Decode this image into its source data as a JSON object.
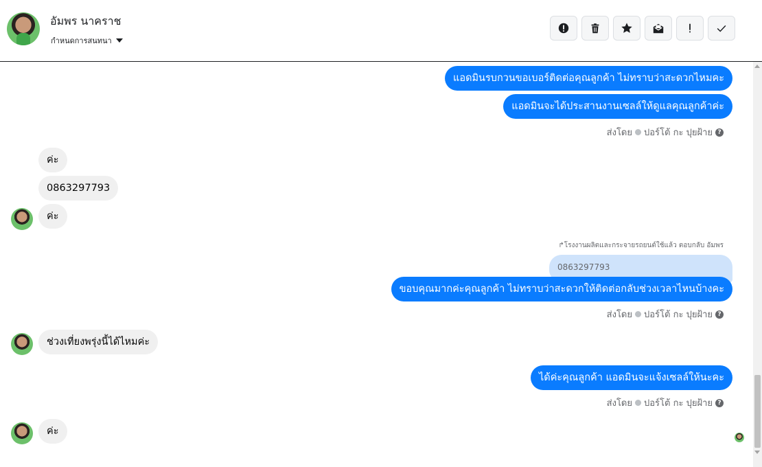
{
  "header": {
    "contact_name": "อัมพร นาคราช",
    "assign_label": "กำหนดการสนทนา",
    "toolbar": [
      {
        "icon": "alert-circle-icon"
      },
      {
        "icon": "trash-icon"
      },
      {
        "icon": "star-icon"
      },
      {
        "icon": "mark-unread-icon"
      },
      {
        "icon": "exclamation-icon"
      },
      {
        "icon": "check-icon"
      }
    ]
  },
  "messages": [
    {
      "dir": "out",
      "text": "แอดมินรบกวนขอเบอร์ติดต่อคุณลูกค้า ไม่ทราบว่าสะดวกไหมคะ"
    },
    {
      "dir": "out",
      "text": "แอดมินจะได้ประสานงานเซลล์ให้ดูแลคุณลูกค้าค่ะ"
    },
    {
      "meta": "ส่งโดย",
      "sender": "ปอร์โต้ กะ ปุยฝ้าย"
    },
    {
      "dir": "in",
      "text": "ค่ะ"
    },
    {
      "dir": "in",
      "text": "0863297793"
    },
    {
      "dir": "in",
      "text": "ค่ะ"
    },
    {
      "reply_note": "โรงงานผลิตและกระจายรถยนต์ใช้แล้ว ตอบกลับ อัมพร"
    },
    {
      "quoted": "0863297793"
    },
    {
      "dir": "out",
      "text": "ขอบคุณมากค่ะคุณลูกค้า ไม่ทราบว่าสะดวกให้ติดต่อกลับช่วงเวลาไหนบ้างคะ"
    },
    {
      "meta": "ส่งโดย",
      "sender": "ปอร์โต้ กะ ปุยฝ้าย"
    },
    {
      "dir": "in",
      "text": "ช่วงเที่ยงพรุ่งนี้ได้ไหมค่ะ"
    },
    {
      "dir": "out",
      "text": "ได้ค่ะคุณลูกค้า แอดมินจะแจ้งเซลล์ให้นะคะ"
    },
    {
      "meta": "ส่งโดย",
      "sender": "ปอร์โต้ กะ ปุยฝ้าย"
    },
    {
      "dir": "in",
      "text": "ค่ะ"
    }
  ],
  "colors": {
    "outgoing": "#0a7cff",
    "incoming": "#f0f0f0",
    "quoted": "#cfe3fb"
  }
}
